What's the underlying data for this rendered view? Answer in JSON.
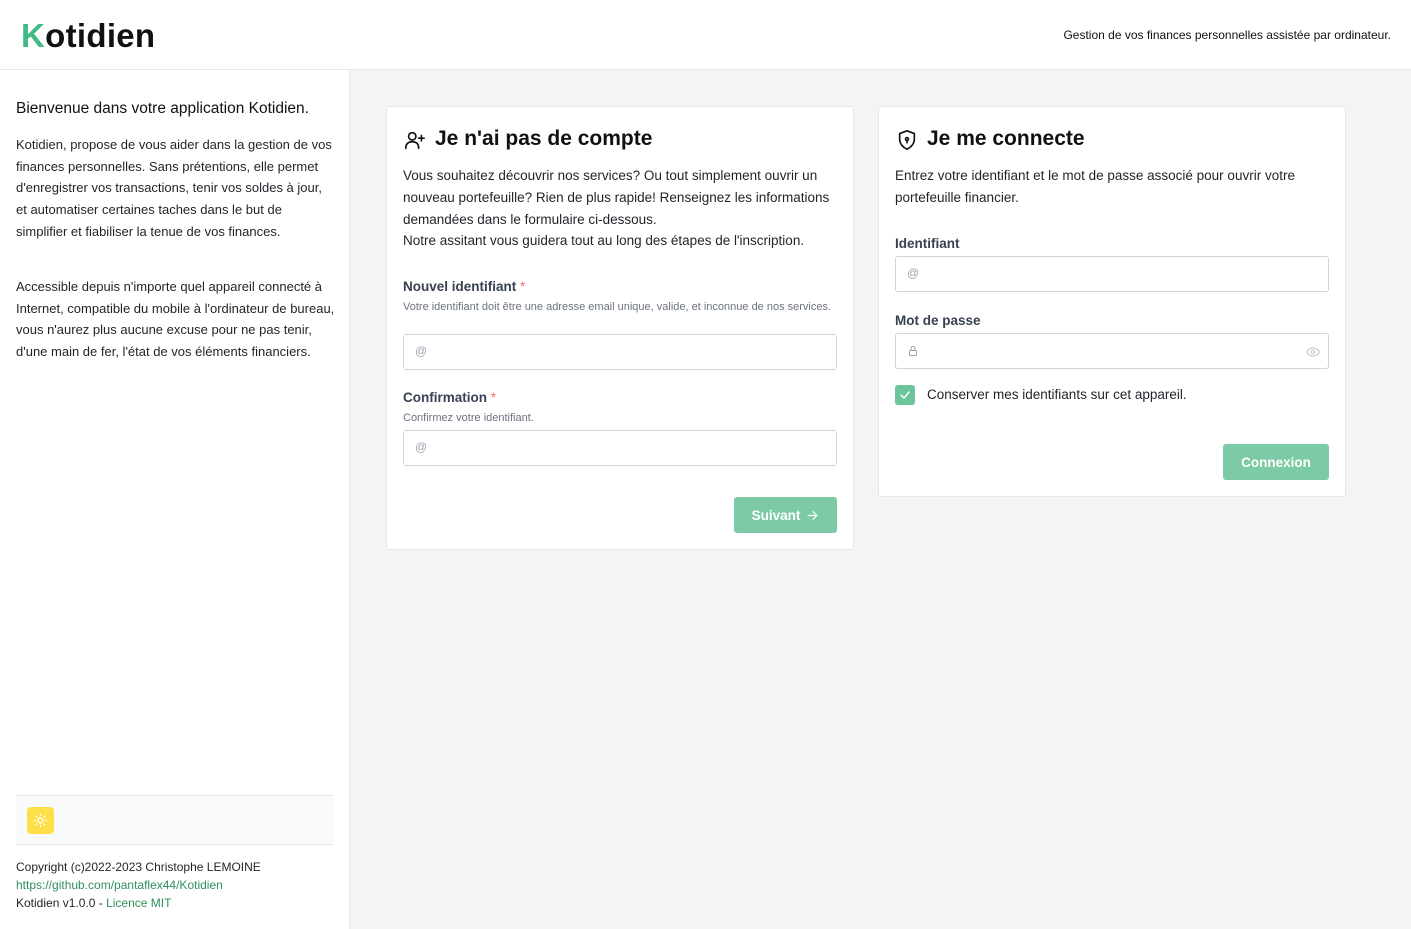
{
  "header": {
    "logo_k": "K",
    "logo_rest": "otidien",
    "tagline": "Gestion de vos finances personnelles assistée par ordinateur."
  },
  "sidebar": {
    "title": "Bienvenue dans votre application Kotidien.",
    "para1": "Kotidien, propose de vous aider dans la gestion de vos finances personnelles. Sans prétentions, elle permet d'enregistrer vos transactions, tenir vos soldes à jour, et automatiser certaines taches dans le but de simplifier et fiabiliser la tenue de vos finances.",
    "para2": "Accessible depuis n'importe quel appareil connecté à Internet, compatible du mobile à l'ordinateur de bureau, vous n'aurez plus aucune excuse pour ne pas tenir, d'une main de fer, l'état de vos éléments financiers.",
    "theme_icon": "sun-icon",
    "copyright": "Copyright (c)2022-2023 Christophe LEMOINE",
    "repo_link": "https://github.com/pantaflex44/Kotidien",
    "version": "Kotidien v1.0.0 - ",
    "license_link": "Licence MIT"
  },
  "register": {
    "title": "Je n'ai pas de compte",
    "icon": "user-plus-icon",
    "desc1": "Vous souhaitez découvrir nos services? Ou tout simplement ouvrir un nouveau portefeuille? Rien de plus rapide! Renseignez les informations demandées dans le formulaire ci-dessous.",
    "desc2": "Notre assitant vous guidera tout au long des étapes de l'inscription.",
    "id_label": "Nouvel identifiant",
    "id_help": "Votre identifiant doit être une adresse email unique, valide, et inconnue de nos services.",
    "confirm_label": "Confirmation",
    "confirm_help": "Confirmez votre identifiant.",
    "required_mark": "*",
    "input_prefix": "@",
    "next_button": "Suivant",
    "next_icon": "arrow-right-icon"
  },
  "login": {
    "title": "Je me connecte",
    "icon": "shield-lock-icon",
    "desc": "Entrez votre identifiant et le mot de passe associé pour ouvrir votre portefeuille financier.",
    "id_label": "Identifiant",
    "input_prefix": "@",
    "password_label": "Mot de passe",
    "password_icon": "lock-icon",
    "show_icon": "eye-icon",
    "remember_label": "Conserver mes identifiants sur cet appareil.",
    "remember_checked": true,
    "login_button": "Connexion"
  },
  "colors": {
    "accent": "#3fb985",
    "button": "#7ccaa6",
    "theme_button": "#fde047"
  }
}
